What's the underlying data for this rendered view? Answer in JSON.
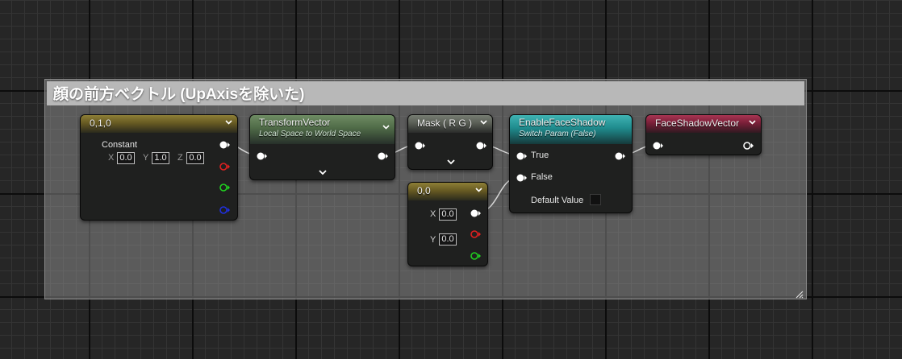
{
  "comment": {
    "title": "顔の前方ベクトル (UpAxisを除いた)"
  },
  "nodes": {
    "constant3": {
      "title": "0,1,0",
      "label": "Constant",
      "x_label": "X",
      "x_value": "0.0",
      "y_label": "Y",
      "y_value": "1.0",
      "z_label": "Z",
      "z_value": "0.0"
    },
    "transform_vector": {
      "title": "TransformVector",
      "subtitle": "Local Space to World Space"
    },
    "mask": {
      "title": "Mask ( R G )"
    },
    "constant2": {
      "title": "0,0",
      "x_label": "X",
      "x_value": "0.0",
      "y_label": "Y",
      "y_value": "0.0"
    },
    "switch_param": {
      "title": "EnableFaceShadow",
      "subtitle": "Switch Param (False)",
      "true_label": "True",
      "false_label": "False",
      "default_label": "Default Value"
    },
    "named_reroute": {
      "title": "FaceShadowVector"
    }
  },
  "colors": {
    "pin_white": "#ffffff",
    "pin_red": "#e02020",
    "pin_green": "#20d020",
    "pin_blue": "#2030e0",
    "wire": "#d8d8d8"
  }
}
